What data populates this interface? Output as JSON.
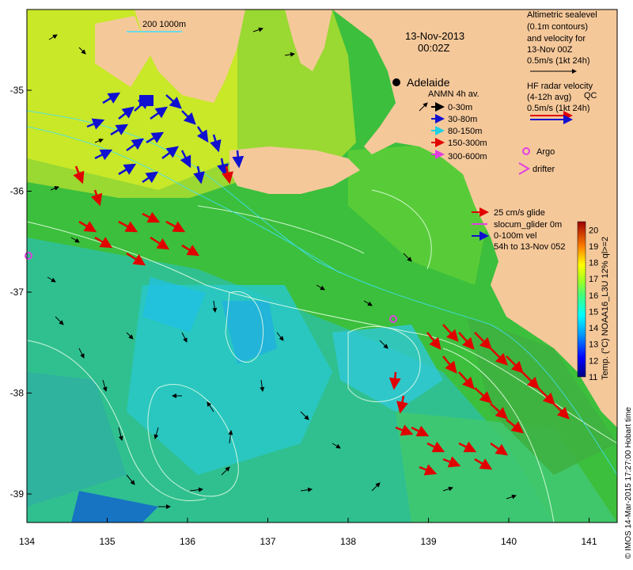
{
  "map": {
    "date": "13-Nov-2013",
    "time": "00:02Z",
    "city": "Adelaide",
    "scale_bar": "200  1000m",
    "x_ticks": [
      "134",
      "135",
      "136",
      "137",
      "138",
      "139",
      "140",
      "141"
    ],
    "y_ticks": [
      "-35",
      "-36",
      "-37",
      "-38",
      "-39"
    ],
    "credit": "© IMOS 14-Mar-2015 17:27:00 Hobart time",
    "colors": {
      "land": "#f5c89a",
      "ocean_green": "#3fbf3f",
      "ocean_cyan": "#2ec8e0",
      "arrow_red": "#e00000",
      "arrow_blue": "#1010d0",
      "argo": "#e040e0"
    }
  },
  "legend": {
    "altimetry": [
      "Altimetric sealevel",
      "(0.1m contours)",
      "and velocity for",
      "13-Nov 00Z",
      "0.5m/s (1kt 24h)"
    ],
    "hf_radar": [
      "HF radar velocity",
      "(4-12h avg)",
      "0.5m/s (1kt 24h)"
    ],
    "hf_overlap": "QC",
    "anmn_title": "ANMN 4h av.",
    "anmn_items": [
      {
        "label": "0-30m",
        "color": "#000000"
      },
      {
        "label": "30-80m",
        "color": "#1010d0"
      },
      {
        "label": "80-150m",
        "color": "#20d0e0"
      },
      {
        "label": "150-300m",
        "color": "#e00000"
      },
      {
        "label": "300-600m",
        "color": "#e040e0"
      }
    ],
    "argo": "Argo",
    "drifter": "drifter",
    "glider": [
      "25 cm/s glide",
      "slocum_glider 0m",
      "0-100m vel",
      "54h to 13-Nov 052"
    ]
  },
  "colorbar": {
    "title": "Temp. (°C) NOAA16_L3U 12% ql>=2",
    "ticks": [
      "20",
      "19",
      "18",
      "17",
      "16",
      "15",
      "14",
      "13",
      "12",
      "11"
    ],
    "range": [
      11,
      20.5
    ]
  }
}
